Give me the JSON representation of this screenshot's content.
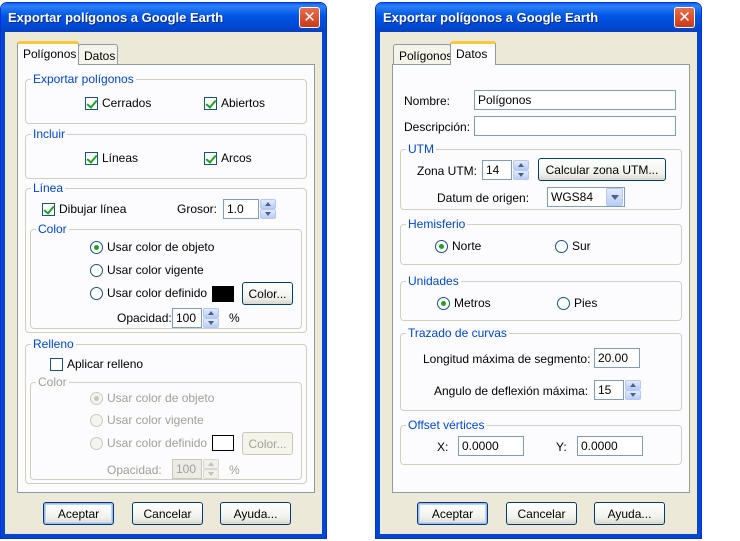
{
  "left": {
    "title": "Exportar polígonos a Google Earth",
    "close_glyph": "✕",
    "tabs": [
      "Polígonos",
      "Datos"
    ],
    "export_group": {
      "title": "Exportar polígonos",
      "cerrados": "Cerrados",
      "abiertos": "Abiertos"
    },
    "include_group": {
      "title": "Incluir",
      "lineas": "Líneas",
      "arcos": "Arcos"
    },
    "line_group": {
      "title": "Línea",
      "draw_line": "Dibujar línea",
      "thickness_label": "Grosor:",
      "thickness_value": "1.0",
      "color": {
        "title": "Color",
        "object_color": "Usar color de objeto",
        "current_color": "Usar color vigente",
        "defined_color": "Usar color definido",
        "swatch_color": "#000000",
        "color_button": "Color...",
        "opacity_label": "Opacidad:",
        "opacity_value": "100",
        "percent": "%"
      }
    },
    "fill_group": {
      "title": "Relleno",
      "apply_fill": "Aplicar relleno",
      "color": {
        "title": "Color",
        "object_color": "Usar color de objeto",
        "current_color": "Usar color vigente",
        "defined_color": "Usar color definido",
        "swatch_color": "#ffffff",
        "color_button": "Color...",
        "opacity_label": "Opacidad:",
        "opacity_value": "100",
        "percent": "%"
      }
    },
    "buttons": {
      "accept": "Aceptar",
      "cancel": "Cancelar",
      "help": "Ayuda..."
    }
  },
  "right": {
    "title": "Exportar polígonos a Google Earth",
    "close_glyph": "✕",
    "tabs": [
      "Polígonos",
      "Datos"
    ],
    "name_label": "Nombre:",
    "name_value": "Polígonos",
    "desc_label": "Descripción:",
    "desc_value": "",
    "utm": {
      "title": "UTM",
      "zone_label": "Zona UTM:",
      "zone_value": "14",
      "calc_button": "Calcular zona UTM...",
      "datum_label": "Datum de origen:",
      "datum_value": "WGS84"
    },
    "hemisphere": {
      "title": "Hemisferio",
      "north": "Norte",
      "south": "Sur"
    },
    "units": {
      "title": "Unidades",
      "meters": "Metros",
      "feet": "Pies"
    },
    "curves": {
      "title": "Trazado de curvas",
      "max_segment_label": "Longitud máxima de segmento:",
      "max_segment_value": "20.00",
      "max_angle_label": "Angulo de deflexión máxima:",
      "max_angle_value": "15"
    },
    "offset": {
      "title": "Offset vértices",
      "x_label": "X:",
      "x_value": "0.0000",
      "y_label": "Y:",
      "y_value": "0.0000"
    },
    "buttons": {
      "accept": "Aceptar",
      "cancel": "Cancelar",
      "help": "Ayuda..."
    }
  },
  "colors": {
    "title_bar": "#0055e5",
    "group_title": "#0046d5",
    "dialog_bg": "#ece9d8",
    "close_button": "#c9381a",
    "check_mark": "#21a121"
  }
}
